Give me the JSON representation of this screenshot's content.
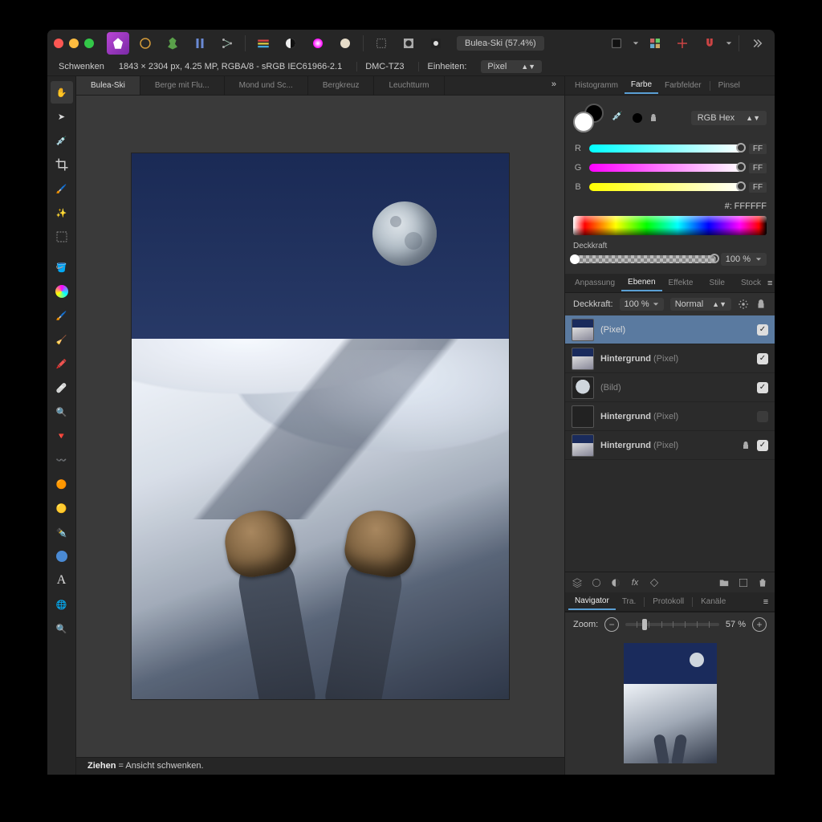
{
  "titlebar": {
    "document": "Bulea-Ski (57.4%)"
  },
  "infobar": {
    "tool": "Schwenken",
    "meta": "1843 × 2304 px, 4.25 MP, RGBA/8 - sRGB IEC61966-2.1",
    "camera": "DMC-TZ3",
    "units_label": "Einheiten:",
    "units_value": "Pixel"
  },
  "doc_tabs": {
    "items": [
      "Bulea-Ski",
      "Berge mit Flu...",
      "Mond und Sc...",
      "Bergkreuz",
      "Leuchtturm"
    ],
    "active": 0
  },
  "right_tabs_top": {
    "items": [
      "Histogramm",
      "Farbe",
      "Farbfelder",
      "Pinsel"
    ],
    "active": 1
  },
  "color": {
    "mode": "RGB Hex",
    "r_label": "R",
    "r_val": "FF",
    "g_label": "G",
    "g_val": "FF",
    "b_label": "B",
    "b_val": "FF",
    "hex_label": "#:",
    "hex_value": "FFFFFF",
    "opacity_label": "Deckkraft",
    "opacity_value": "100 %"
  },
  "right_tabs_mid": {
    "items": [
      "Anpassung",
      "Ebenen",
      "Effekte",
      "Stile",
      "Stock"
    ],
    "active": 1
  },
  "layers_head": {
    "opacity_label": "Deckkraft:",
    "opacity_value": "100 %",
    "blend_mode": "Normal"
  },
  "layers": [
    {
      "name": "",
      "type": "(Pixel)",
      "thumb": "mtn",
      "checked": true,
      "locked": false,
      "active": true
    },
    {
      "name": "Hintergrund",
      "type": "(Pixel)",
      "thumb": "mtn",
      "checked": true,
      "locked": false,
      "active": false
    },
    {
      "name": "",
      "type": "(Bild)",
      "thumb": "moon",
      "checked": true,
      "locked": false,
      "active": false
    },
    {
      "name": "Hintergrund",
      "type": "(Pixel)",
      "thumb": "blank",
      "checked": false,
      "locked": false,
      "active": false
    },
    {
      "name": "Hintergrund",
      "type": "(Pixel)",
      "thumb": "mtn",
      "checked": true,
      "locked": true,
      "active": false
    }
  ],
  "right_tabs_bot": {
    "items": [
      "Navigator",
      "Tra.",
      "Protokoll",
      "Kanäle"
    ],
    "active": 0
  },
  "navigator": {
    "zoom_label": "Zoom:",
    "zoom_value": "57 %"
  },
  "status": {
    "bold": "Ziehen",
    "rest": " = Ansicht schwenken."
  }
}
